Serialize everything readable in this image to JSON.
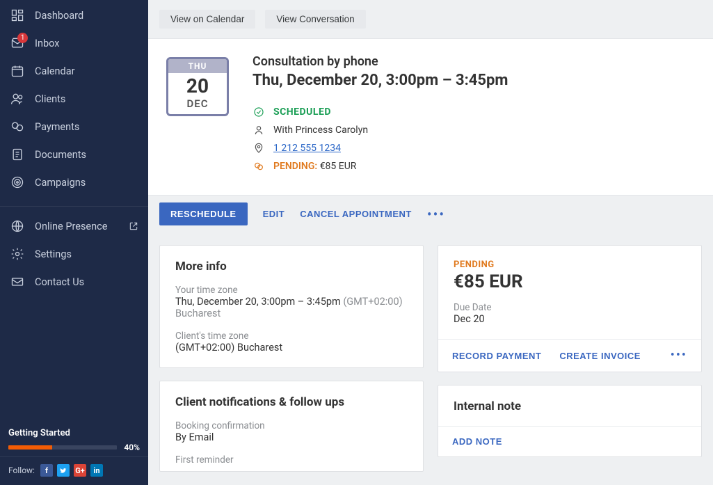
{
  "sidebar": {
    "items": [
      {
        "label": "Dashboard",
        "icon": "dashboard"
      },
      {
        "label": "Inbox",
        "icon": "inbox",
        "badge": "1"
      },
      {
        "label": "Calendar",
        "icon": "calendar"
      },
      {
        "label": "Clients",
        "icon": "clients"
      },
      {
        "label": "Payments",
        "icon": "payments"
      },
      {
        "label": "Documents",
        "icon": "documents"
      },
      {
        "label": "Campaigns",
        "icon": "campaigns"
      }
    ],
    "items2": [
      {
        "label": "Online Presence",
        "icon": "globe",
        "external": true
      },
      {
        "label": "Settings",
        "icon": "settings"
      },
      {
        "label": "Contact Us",
        "icon": "mail"
      }
    ],
    "getting_started": {
      "title": "Getting Started",
      "pct_label": "40%",
      "pct": 40
    },
    "follow_label": "Follow:"
  },
  "topbar": {
    "view_calendar": "View on Calendar",
    "view_conversation": "View Conversation"
  },
  "hero": {
    "date_card": {
      "dow": "THU",
      "day": "20",
      "mon": "DEC"
    },
    "title": "Consultation by phone",
    "time": "Thu, December 20, 3:00pm – 3:45pm",
    "status": "SCHEDULED",
    "with": "With Princess Carolyn",
    "phone": "1 212 555 1234",
    "pending_label": "PENDING:",
    "pending_amount": "€85 EUR"
  },
  "actionbar": {
    "reschedule": "RESCHEDULE",
    "edit": "EDIT",
    "cancel": "CANCEL APPOINTMENT"
  },
  "moreinfo": {
    "title": "More info",
    "your_tz_label": "Your time zone",
    "your_tz_time": "Thu, December 20, 3:00pm – 3:45pm",
    "your_tz_zone": "(GMT+02:00) Bucharest",
    "client_tz_label": "Client's time zone",
    "client_tz_zone": "(GMT+02:00) Bucharest"
  },
  "notifications": {
    "title": "Client notifications & follow ups",
    "booking_label": "Booking confirmation",
    "booking_val": "By Email",
    "first_reminder_label": "First reminder"
  },
  "payment": {
    "status": "PENDING",
    "amount": "€85 EUR",
    "due_label": "Due Date",
    "due_val": "Dec 20",
    "record": "RECORD PAYMENT",
    "invoice": "CREATE INVOICE"
  },
  "note": {
    "title": "Internal note",
    "add": "ADD NOTE"
  }
}
